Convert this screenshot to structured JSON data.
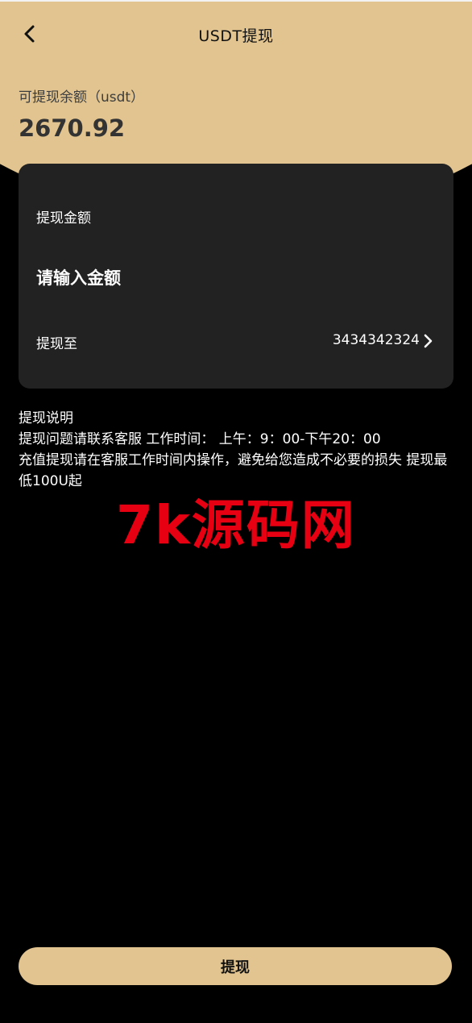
{
  "header": {
    "title": "USDT提现"
  },
  "balance": {
    "label": "可提现余额（usdt）",
    "value": "2670.92"
  },
  "form": {
    "amount_label": "提现金额",
    "amount_placeholder": "请输入金额",
    "amount_value": "",
    "destination_label": "提现至",
    "destination_value": "3434342324"
  },
  "notes": {
    "title": "提现说明",
    "line1": "提现问题请联系客服 工作时间： 上午：9：00-下午20：00",
    "line2": "充值提现请在客服工作时间内操作，避免给您造成不必要的损失 提现最低100U起"
  },
  "watermark": {
    "text": "7k源码网"
  },
  "footer": {
    "submit_label": "提现"
  },
  "colors": {
    "accent": "#E1C48F",
    "background": "#000000",
    "card": "#222222",
    "watermark": "#E60012"
  },
  "icons": {
    "back": "chevron-left-icon",
    "destination": "chevron-right-icon"
  }
}
